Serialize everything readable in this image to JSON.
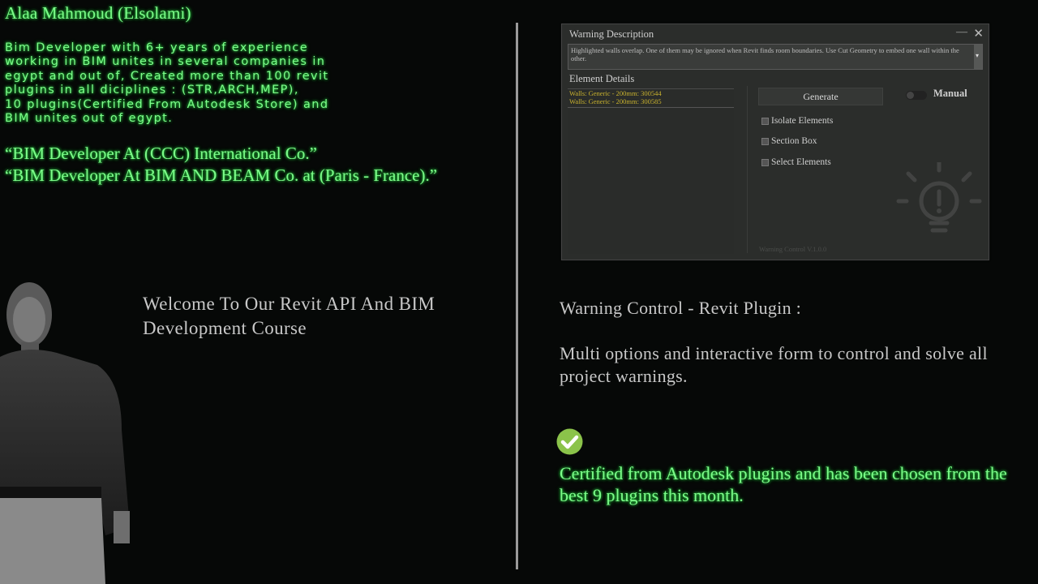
{
  "left": {
    "name": "Alaa Mahmoud (Elsolami)",
    "bio": "Bim Developer with 6+ years of experience\nworking in BIM unites in several companies in\negypt and out of, Created more than 100 revit\nplugins in all diciplines : (STR,ARCH,MEP),\n10 plugins(Certified From Autodesk Store) and\nBIM unites out of egypt.",
    "roles": [
      "“BIM Developer At (CCC) International Co.”",
      "“BIM Developer At BIM AND BEAM Co. at (Paris - France).”"
    ],
    "welcome": "Welcome To Our Revit API And BIM Development Course"
  },
  "window": {
    "title": "Warning Description",
    "minimize": "—",
    "close": "✕",
    "description": "Highlighted walls overlap. One of them may be ignored when Revit finds room boundaries. Use Cut Geometry to embed one wall within the other.",
    "scroll_arrow": "▾",
    "element_details_title": "Element Details",
    "elements": [
      "Walls: Generic - 200mm: 300544",
      "Walls: Generic - 200mm: 300585"
    ],
    "generate_label": "Generate",
    "manual_label": "Manual",
    "options": [
      "Isolate Elements",
      "Section Box",
      "Select Elements"
    ],
    "version": "Warning Control V.1.0.0"
  },
  "right": {
    "plugin_title": "Warning Control - Revit Plugin :",
    "plugin_desc": "Multi options and interactive form to control and solve all project warnings.",
    "certified": "Certified from Autodesk plugins and has been chosen from the best 9 plugins this month."
  },
  "colors": {
    "accent_green": "#7dfc8a",
    "element_text": "#c9b22e",
    "check_green": "#8bc34a"
  }
}
